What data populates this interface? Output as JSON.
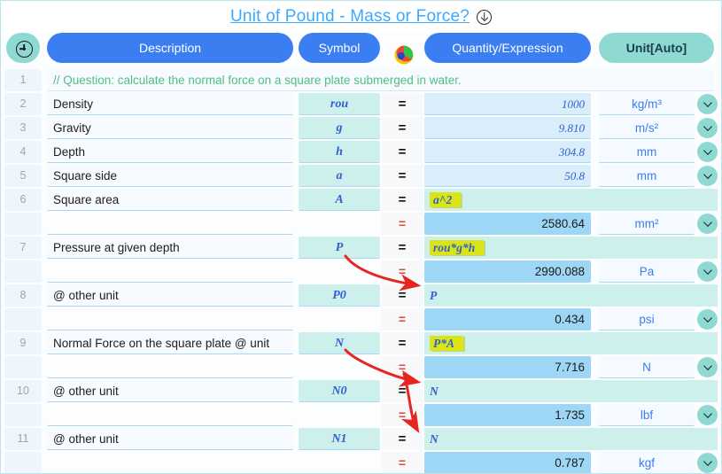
{
  "title": {
    "text": "Unit of Pound - Mass or Force?",
    "icon": "download-circle-icon"
  },
  "header": {
    "add_icon": "plus-circle-icon",
    "color_wheel_icon": "color-wheel-icon",
    "columns": [
      {
        "label": "Description",
        "style": "blue"
      },
      {
        "label": "Symbol",
        "style": "blue"
      },
      {
        "label": "Quantity/Expression",
        "style": "blue"
      },
      {
        "label": "Unit[Auto]",
        "style": "teal"
      }
    ]
  },
  "colors": {
    "header_blue": "#3b7ef2",
    "header_teal": "#8fd9d3",
    "title_blue": "#3da9fc",
    "comment_green": "#4fbf86",
    "symbol_blue": "#2f5fd0",
    "result_fill": "#9ed6f5",
    "expr_fill": "#cdf0ec",
    "highlight_yellow": "#dbe515",
    "arrow_red": "#e8241f",
    "equals_result_red": "#e0483a"
  },
  "rows": [
    {
      "num": "1",
      "kind": "comment",
      "description": "// Question: calculate the normal force on a square plate submerged in water."
    },
    {
      "num": "2",
      "kind": "value",
      "description": "Density",
      "symbol": "rou",
      "eq": "=",
      "quantity": "1000",
      "unit": "kg/m³",
      "dropdown": true
    },
    {
      "num": "3",
      "kind": "value",
      "description": "Gravity",
      "symbol": "g",
      "eq": "=",
      "quantity": "9.810",
      "unit": "m/s²",
      "dropdown": true
    },
    {
      "num": "4",
      "kind": "value",
      "description": "Depth",
      "symbol": "h",
      "eq": "=",
      "quantity": "304.8",
      "unit": "mm",
      "dropdown": true
    },
    {
      "num": "5",
      "kind": "value",
      "description": "Square side",
      "symbol": "a",
      "eq": "=",
      "quantity": "50.8",
      "unit": "mm",
      "dropdown": true
    },
    {
      "num": "6",
      "kind": "expr",
      "description": "Square area",
      "symbol": "A",
      "eq": "=",
      "expression": "a^2",
      "highlight": true
    },
    {
      "num": "",
      "kind": "result",
      "description": "",
      "symbol": "",
      "eq": "=",
      "quantity": "2580.64",
      "unit": "mm²",
      "dropdown": true
    },
    {
      "num": "7",
      "kind": "expr",
      "description": "Pressure at given depth",
      "symbol": "P",
      "eq": "=",
      "expression": "rou*g*h",
      "highlight": true
    },
    {
      "num": "",
      "kind": "result",
      "description": "",
      "symbol": "",
      "eq": "=",
      "quantity": "2990.088",
      "unit": "Pa",
      "dropdown": true
    },
    {
      "num": "8",
      "kind": "expr",
      "description": "@ other unit",
      "symbol": "P0",
      "eq": "=",
      "expression": "P",
      "highlight": false
    },
    {
      "num": "",
      "kind": "result",
      "description": "",
      "symbol": "",
      "eq": "=",
      "quantity": "0.434",
      "unit": "psi",
      "dropdown": true
    },
    {
      "num": "9",
      "kind": "expr",
      "description": "Normal Force on the square plate @ unit",
      "symbol": "N",
      "eq": "=",
      "expression": "P*A",
      "highlight": true
    },
    {
      "num": "",
      "kind": "result",
      "description": "",
      "symbol": "",
      "eq": "=",
      "quantity": "7.716",
      "unit": "N",
      "dropdown": true
    },
    {
      "num": "10",
      "kind": "expr",
      "description": "@ other unit",
      "symbol": "N0",
      "eq": "=",
      "expression": "N",
      "highlight": false
    },
    {
      "num": "",
      "kind": "result",
      "description": "",
      "symbol": "",
      "eq": "=",
      "quantity": "1.735",
      "unit": "lbf",
      "dropdown": true
    },
    {
      "num": "11",
      "kind": "expr",
      "description": "@ other unit",
      "symbol": "N1",
      "eq": "=",
      "expression": "N",
      "highlight": false
    },
    {
      "num": "",
      "kind": "result",
      "description": "",
      "symbol": "",
      "eq": "=",
      "quantity": "0.787",
      "unit": "kgf",
      "dropdown": true
    }
  ],
  "annotations": {
    "arrows": [
      {
        "name": "arrow-p-to-p0",
        "from": "row7-symbol-P",
        "to": "row8-expression-P"
      },
      {
        "name": "arrow-n-to-n0",
        "from": "row9-symbol-N",
        "to": "row10-expression-N"
      },
      {
        "name": "arrow-n-to-n1",
        "from": "row9-symbol-N",
        "to": "row11-expression-N"
      }
    ]
  }
}
